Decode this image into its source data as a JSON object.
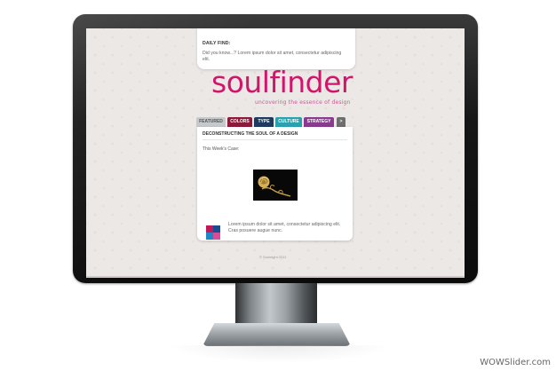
{
  "daily": {
    "title": "DAILY FIND:",
    "text": "Did you know...? Lorem ipsum dolor sit amet, consectetur adipiscing elit."
  },
  "logo": {
    "name": "soulfinder",
    "tagline": "uncovering the essence of design"
  },
  "tabs": [
    {
      "label": "FEATURED",
      "color": "#c5c9cc"
    },
    {
      "label": "COLORS",
      "color": "#8c1a3a"
    },
    {
      "label": "TYPE",
      "color": "#1e3a5f"
    },
    {
      "label": "CULTURE",
      "color": "#2aa1ae"
    },
    {
      "label": "STRATEGY",
      "color": "#8a3a8f"
    },
    {
      "label": ">",
      "color": "#6e6e6e"
    }
  ],
  "article": {
    "heading": "DECONSTRUCTING THE SOUL OF A DESIGN",
    "subheading": "This Week's Case:",
    "text": "Lorem ipsum dolor sit amet, consectetur adipiscing elit. Cras posuere augue nunc."
  },
  "swatches": [
    "#c2185b",
    "#1a4d8f",
    "#1e88c7",
    "#d64b9a"
  ],
  "footer": "© Soulnight 2011",
  "watermark": "WOWSlider.com"
}
